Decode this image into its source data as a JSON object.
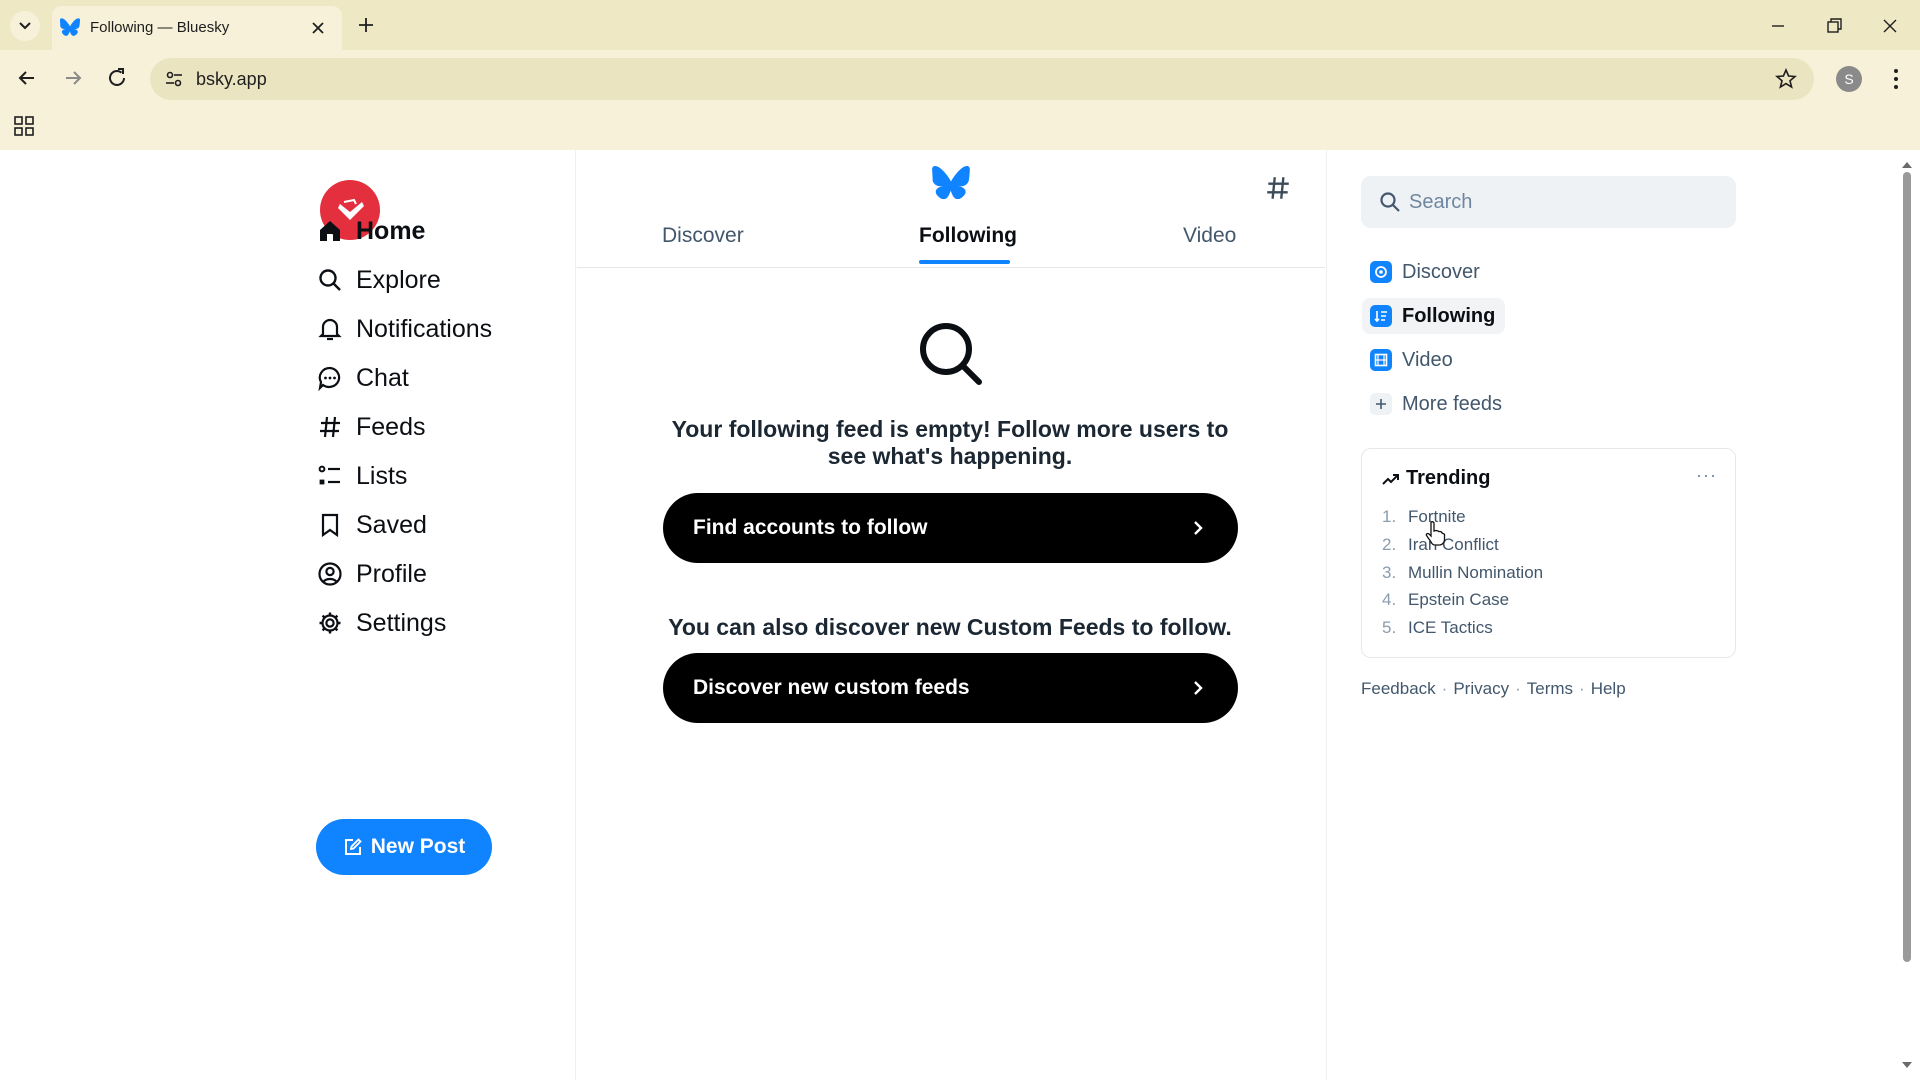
{
  "browser": {
    "tab_title": "Following — Bluesky",
    "url": "bsky.app",
    "profile_initial": "S"
  },
  "nav": {
    "items": [
      {
        "label": "Home",
        "icon": "home-icon"
      },
      {
        "label": "Explore",
        "icon": "search-icon"
      },
      {
        "label": "Notifications",
        "icon": "bell-icon"
      },
      {
        "label": "Chat",
        "icon": "chat-bubble-icon"
      },
      {
        "label": "Feeds",
        "icon": "hash-icon"
      },
      {
        "label": "Lists",
        "icon": "list-icon"
      },
      {
        "label": "Saved",
        "icon": "bookmark-icon"
      },
      {
        "label": "Profile",
        "icon": "profile-icon"
      },
      {
        "label": "Settings",
        "icon": "gear-icon"
      }
    ],
    "new_post": "New Post"
  },
  "feed_tabs": [
    "Discover",
    "Following",
    "Video"
  ],
  "empty_state": {
    "message": "Your following feed is empty! Follow more users to see what's happening.",
    "find_accounts": "Find accounts to follow",
    "alt_message": "You can also discover new Custom Feeds to follow.",
    "discover_feeds": "Discover new custom feeds"
  },
  "sidebar": {
    "search_placeholder": "Search",
    "feeds": [
      "Discover",
      "Following",
      "Video"
    ],
    "more_feeds": "More feeds",
    "trending": {
      "title": "Trending",
      "items": [
        {
          "num": "1.",
          "label": "Fortnite"
        },
        {
          "num": "2.",
          "label": "Iran Conflict"
        },
        {
          "num": "3.",
          "label": "Mullin Nomination"
        },
        {
          "num": "4.",
          "label": "Epstein Case"
        },
        {
          "num": "5.",
          "label": "ICE Tactics"
        }
      ]
    },
    "footer": [
      "Feedback",
      "Privacy",
      "Terms",
      "Help"
    ]
  },
  "colors": {
    "accent": "#1083fe",
    "logo": "#e4303e",
    "chrome": "#f6f1d8"
  }
}
